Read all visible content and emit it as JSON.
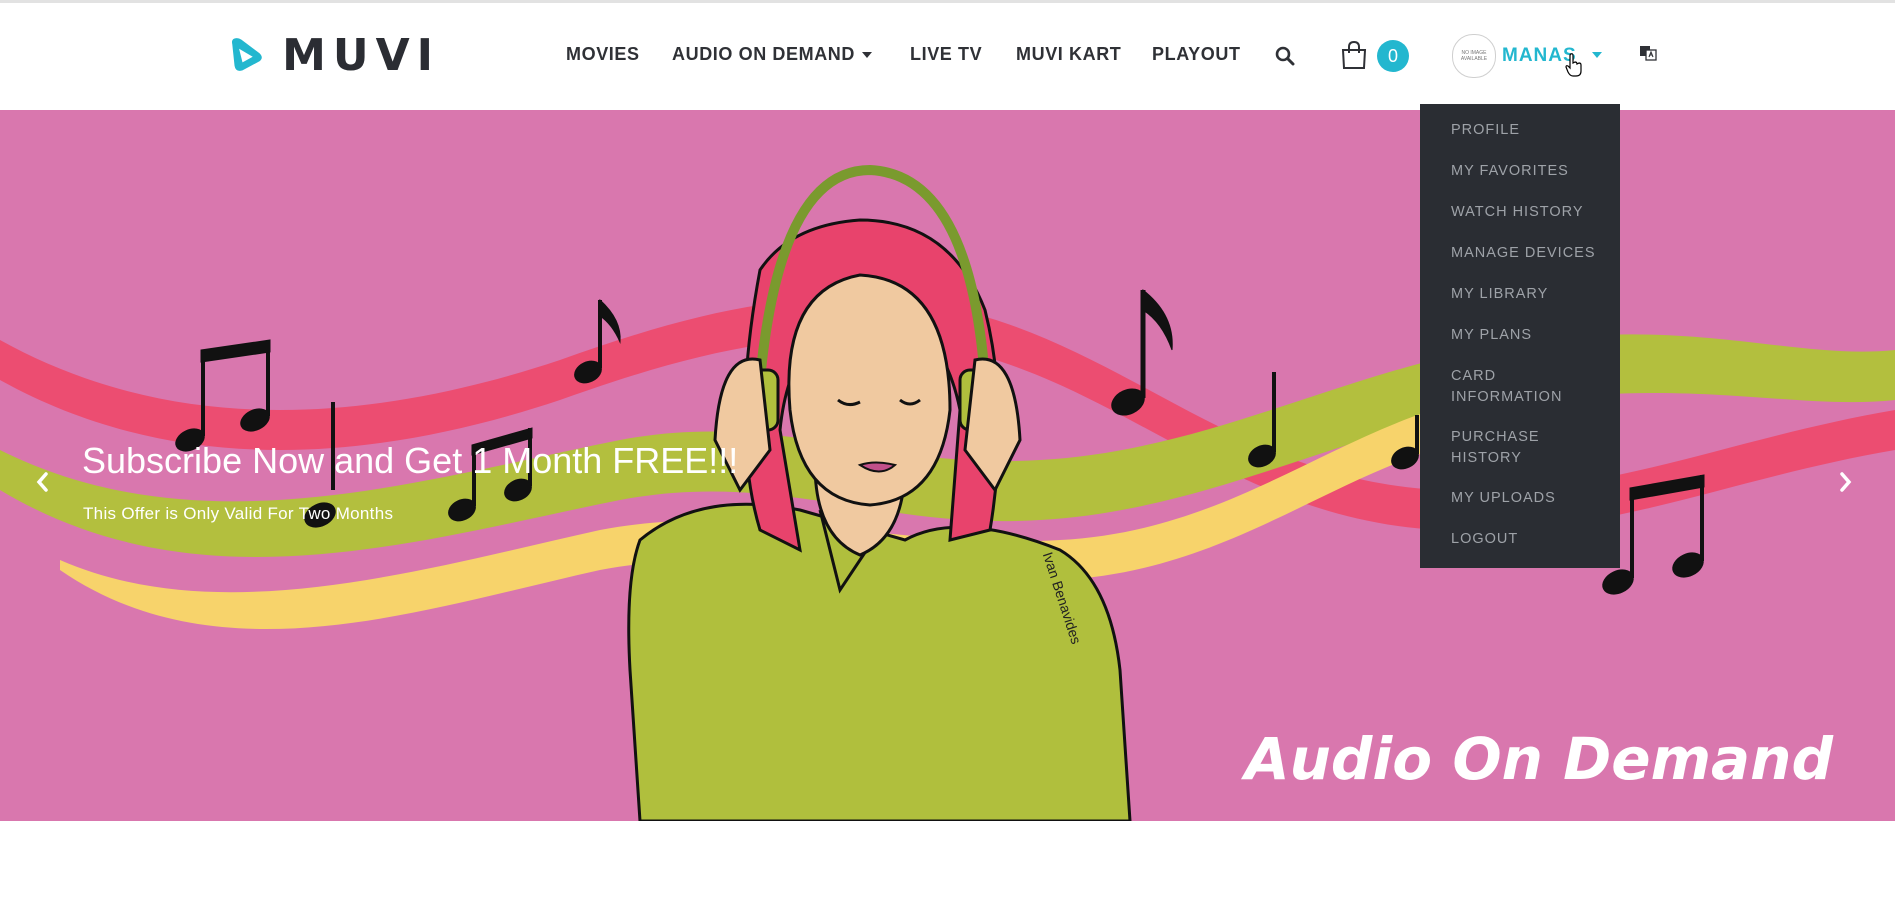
{
  "brand": {
    "name": "MUVI",
    "accent_color": "#23b7cf"
  },
  "nav": {
    "items": [
      {
        "label": "MOVIES"
      },
      {
        "label": "AUDIO ON DEMAND"
      },
      {
        "label": "LIVE TV"
      },
      {
        "label": "MUVI KART"
      },
      {
        "label": "PLAYOUT"
      }
    ],
    "search_icon": "search-icon",
    "cart": {
      "icon": "shopping-bag-icon",
      "count": "0"
    },
    "user": {
      "avatar_text": "NO IMAGE AVAILABLE",
      "name": "MANAS",
      "caret_icon": "caret-down-icon"
    },
    "language_icon": "language-icon"
  },
  "user_menu": {
    "items": [
      {
        "label": "PROFILE"
      },
      {
        "label": "MY FAVORITES"
      },
      {
        "label": "WATCH HISTORY"
      },
      {
        "label": "MANAGE DEVICES"
      },
      {
        "label": "MY LIBRARY"
      },
      {
        "label": "MY PLANS"
      },
      {
        "label": "CARD\nINFORMATION"
      },
      {
        "label": "PURCHASE\nHISTORY"
      },
      {
        "label": "MY UPLOADS"
      },
      {
        "label": "LOGOUT"
      }
    ]
  },
  "hero": {
    "title": "Subscribe Now and Get 1 Month FREE!!!",
    "subtitle": "This Offer is Only Valid For Two Months",
    "overlay_text": "Audio On Demand",
    "artist_signature": "Ivan Benavides",
    "background_color": "#d977ae",
    "prev_icon": "chevron-left-icon",
    "next_icon": "chevron-right-icon"
  }
}
